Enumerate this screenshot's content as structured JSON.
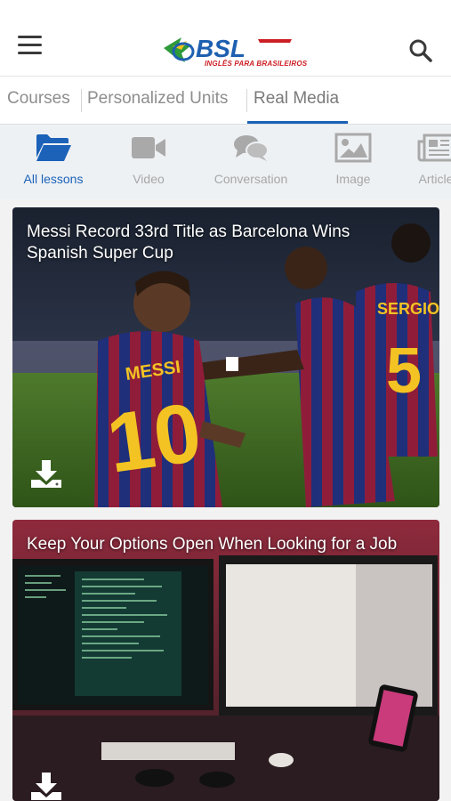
{
  "header": {
    "logo_text": "BSL",
    "logo_tagline": "INGLÊS PARA BRASILEIROS"
  },
  "tabs": [
    {
      "label": "Courses"
    },
    {
      "label": "Personalized Units"
    },
    {
      "label": "Real Media",
      "active": true
    }
  ],
  "filters": [
    {
      "label": "All lessons",
      "icon": "folder-icon",
      "active": true
    },
    {
      "label": "Video",
      "icon": "video-camera-icon"
    },
    {
      "label": "Conversation",
      "icon": "chat-bubbles-icon"
    },
    {
      "label": "Image",
      "icon": "image-icon"
    },
    {
      "label": "Article",
      "icon": "newspaper-icon"
    }
  ],
  "lessons": [
    {
      "title": "Messi Record 33rd Title as Barcelona Wins Spanish Super Cup",
      "icon": "download-icon"
    },
    {
      "title": "Keep Your Options Open When Looking for a Job",
      "icon": "download-icon"
    }
  ],
  "colors": {
    "accent": "#1b62b8",
    "brand_blue": "#1d5fb0",
    "brand_red": "#cc1f25",
    "inactive": "#a7a7a7"
  }
}
